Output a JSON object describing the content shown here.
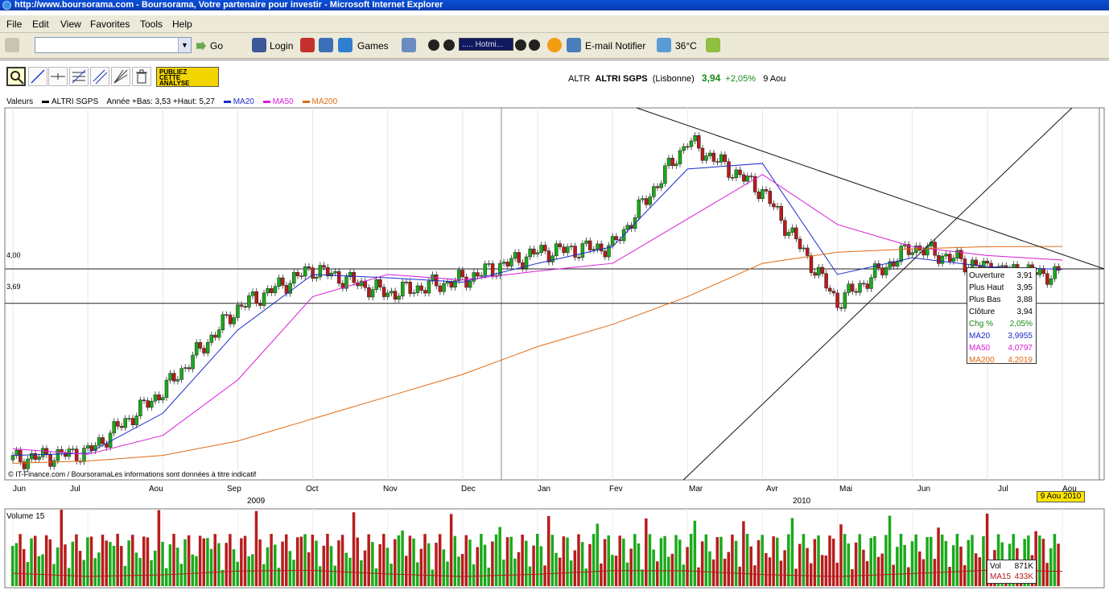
{
  "window": {
    "title": "http://www.boursorama.com - Boursorama, Votre partenaire pour investir - Microsoft Internet Explorer"
  },
  "menu": [
    "File",
    "Edit",
    "View",
    "Favorites",
    "Tools",
    "Help"
  ],
  "toolbar": {
    "address_value": "",
    "go_label": "Go",
    "login_label": "Login",
    "games_label": "Games",
    "hotmail_label": "..... Hotmi...",
    "email_label": "E-mail Notifier",
    "weather_label": "36°C"
  },
  "promo": {
    "line1": "PUBLIEZ",
    "line2": "CETTE",
    "line3": "ANALYSE"
  },
  "quote": {
    "ticker": "ALTR",
    "name": "ALTRI SGPS",
    "market": "(Lisbonne)",
    "price": "3,94",
    "change": "+2,05%",
    "date": "9 Aou"
  },
  "legend": {
    "valeurs": "Valeurs",
    "series_name": "ALTRI SGPS",
    "range": "Année +Bas: 3,53 +Haut: 5,27",
    "ma20": "MA20",
    "ma50": "MA50",
    "ma200": "MA200"
  },
  "levels": {
    "upper": "4,00",
    "lower": "3,69"
  },
  "credit": "© IT-Finance.com / BoursoramaLes informations sont données à titre indicatif",
  "x_axis": {
    "months": [
      "Jun",
      "Jul",
      "Aou",
      "Sep",
      "Oct",
      "Nov",
      "Dec",
      "Jan",
      "Fev",
      "Mar",
      "Avr",
      "Mai",
      "Jun",
      "Jul",
      "Aou"
    ],
    "years": [
      "2009",
      "2010"
    ]
  },
  "tooltip": {
    "rows": [
      {
        "label": "Ouverture",
        "value": "3,91"
      },
      {
        "label": "Plus Haut",
        "value": "3,95"
      },
      {
        "label": "Plus Bas",
        "value": "3,88"
      },
      {
        "label": "Clôture",
        "value": "3,94"
      },
      {
        "label": "Chg %",
        "value": "2,05%"
      },
      {
        "label": "MA20",
        "value": "3,9955"
      },
      {
        "label": "MA50",
        "value": "4,0797"
      },
      {
        "label": "MA200",
        "value": "4,2019"
      }
    ]
  },
  "date_badge": "9 Aou 2010",
  "volume": {
    "title": "Volume 15",
    "vol_label": "Vol",
    "vol_value": "871K",
    "ma_label": "MA15",
    "ma_value": "433K"
  },
  "colors": {
    "up": "#1aaa1a",
    "down": "#b81c1c",
    "ma20": "#1c2cc8",
    "ma50": "#d81cd8",
    "ma200": "#e06a10"
  },
  "chart_data": {
    "type": "line",
    "title": "ALTRI SGPS",
    "ylabel": "",
    "horizontal_levels": [
      4.0,
      3.69
    ],
    "x": [
      "2009-06",
      "2009-07",
      "2009-08",
      "2009-09",
      "2009-10",
      "2009-11",
      "2009-12",
      "2010-01",
      "2010-02",
      "2010-03",
      "2010-04",
      "2010-05",
      "2010-06",
      "2010-07",
      "2010-08"
    ],
    "series": [
      {
        "name": "ALTRI SGPS",
        "values": [
          2.28,
          2.35,
          2.9,
          3.65,
          4.0,
          3.78,
          3.9,
          4.15,
          4.2,
          5.15,
          4.7,
          3.7,
          4.2,
          4.0,
          3.94
        ]
      },
      {
        "name": "MA20",
        "values": [
          2.32,
          2.34,
          2.7,
          3.45,
          3.95,
          3.92,
          3.88,
          4.05,
          4.2,
          4.9,
          4.95,
          3.95,
          4.1,
          4.02,
          3.9955
        ]
      },
      {
        "name": "MA50",
        "values": [
          2.38,
          2.33,
          2.5,
          3.0,
          3.75,
          3.95,
          3.9,
          3.98,
          4.05,
          4.45,
          4.85,
          4.4,
          4.2,
          4.12,
          4.0797
        ]
      },
      {
        "name": "MA200",
        "values": [
          2.25,
          2.27,
          2.32,
          2.45,
          2.65,
          2.85,
          3.05,
          3.3,
          3.5,
          3.75,
          4.05,
          4.15,
          4.18,
          4.2,
          4.2019
        ]
      }
    ]
  }
}
